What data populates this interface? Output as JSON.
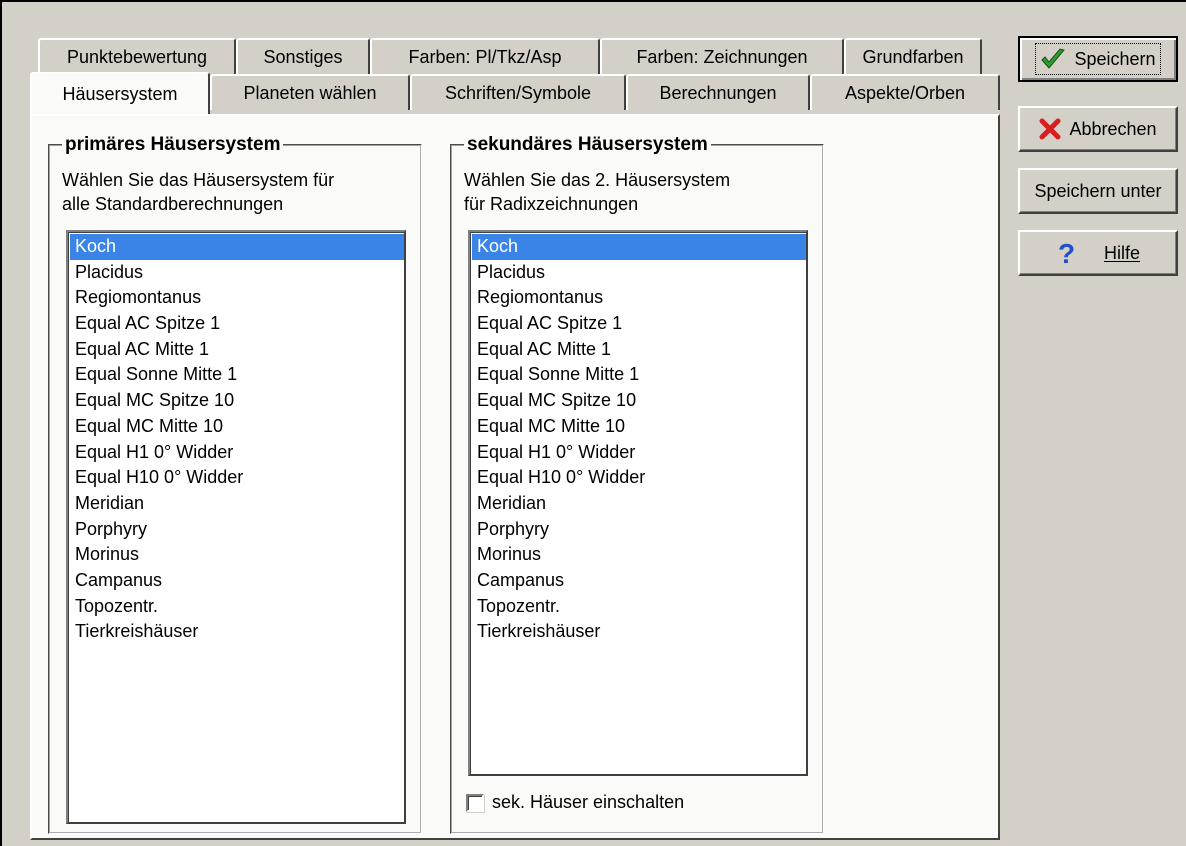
{
  "tabs_back_row": [
    "Punktebewertung",
    "Sonstiges",
    "Farben: Pl/Tkz/Asp",
    "Farben: Zeichnungen",
    "Grundfarben"
  ],
  "tabs_front_row": [
    "Häusersystem",
    "Planeten wählen",
    "Schriften/Symbole",
    "Berechnungen",
    "Aspekte/Orben"
  ],
  "active_tab": "Häusersystem",
  "primary": {
    "title": "primäres Häusersystem",
    "desc_line1": "Wählen Sie das Häusersystem für",
    "desc_line2": "alle Standardberechnungen",
    "selected": "Koch"
  },
  "secondary": {
    "title": "sekundäres Häusersystem",
    "desc_line1": "Wählen Sie das 2. Häusersystem",
    "desc_line2": "für Radixzeichnungen",
    "selected": "Koch",
    "checkbox_label": "sek. Häuser einschalten",
    "checkbox_checked": false
  },
  "house_systems": [
    "Koch",
    "Placidus",
    "Regiomontanus",
    "Equal AC Spitze 1",
    "Equal AC Mitte 1",
    "Equal Sonne Mitte 1",
    "Equal MC Spitze 10",
    "Equal MC Mitte 10",
    "Equal H1 0° Widder",
    "Equal H10 0° Widder",
    "Meridian",
    "Porphyry",
    "Morinus",
    "Campanus",
    "Topozentr.",
    "Tierkreishäuser"
  ],
  "buttons": {
    "save": "Speichern",
    "cancel": "Abbrechen",
    "save_as": "Speichern unter",
    "help": "Hilfe"
  },
  "colors": {
    "selection": "#3a84e8",
    "panel": "#fafaf8",
    "dialog": "#d4d0c8",
    "check_green": "#2e9b2e",
    "cancel_red": "#d81e1e",
    "help_blue": "#1f4fcc"
  }
}
